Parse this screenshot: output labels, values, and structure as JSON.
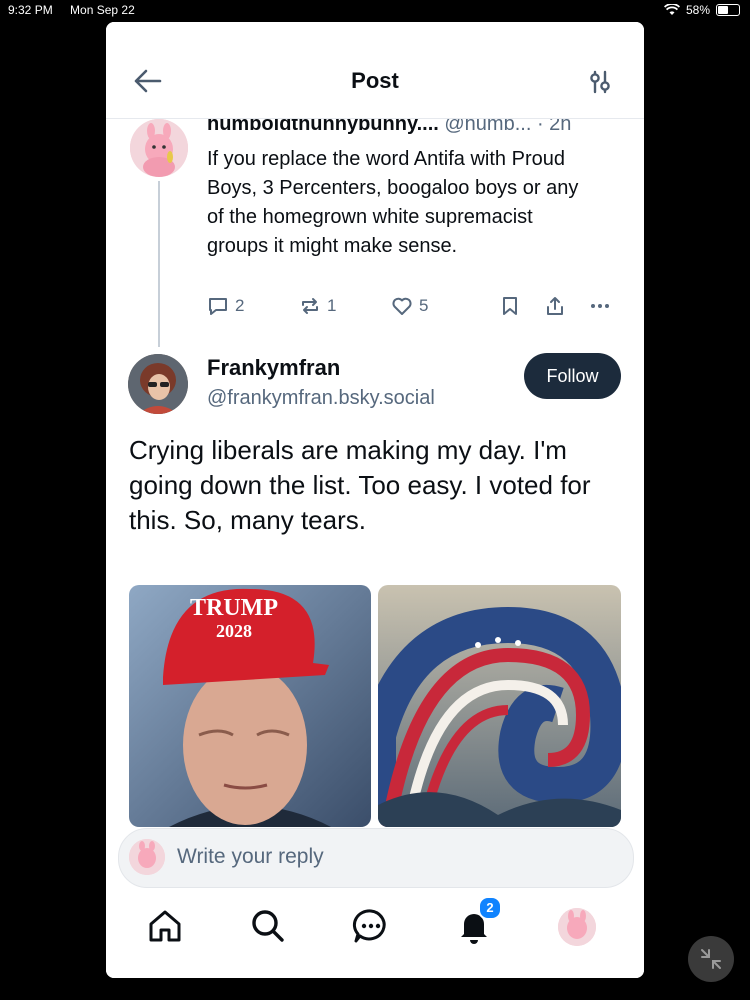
{
  "status": {
    "time": "9:32 PM",
    "date": "Mon Sep 22",
    "battery": "58%",
    "battery_level": 0.58
  },
  "header": {
    "title": "Post"
  },
  "parent_post": {
    "display_name": "humboldthunnybunny....",
    "handle": "@humb...",
    "time": "· 2h",
    "text": "If you replace the word Antifa with Proud Boys, 3 Percenters, boogaloo boys or any of the homegrown white supremacist groups it might make sense.",
    "replies": "2",
    "reposts": "1",
    "likes": "5"
  },
  "main_post": {
    "display_name": "Frankymfran",
    "handle": "@frankymfran.bsky.social",
    "follow_label": "Follow",
    "text": "Crying liberals are making my day.  I'm going down the list.  Too easy.  I voted for this.  So, many tears.",
    "image1_cap_text": "TRUMP",
    "image1_cap_year": "2028"
  },
  "reply": {
    "placeholder": "Write your reply"
  },
  "tabbar": {
    "notifications_badge": "2"
  },
  "colors": {
    "accent": "#1083fe",
    "follow_bg": "#1c2b3c",
    "muted": "#56687d"
  },
  "icons": [
    "back-arrow-icon",
    "filter-icon",
    "reply-icon",
    "repost-icon",
    "like-icon",
    "bookmark-icon",
    "share-icon",
    "more-icon",
    "home-icon",
    "search-icon",
    "chat-icon",
    "bell-icon"
  ]
}
